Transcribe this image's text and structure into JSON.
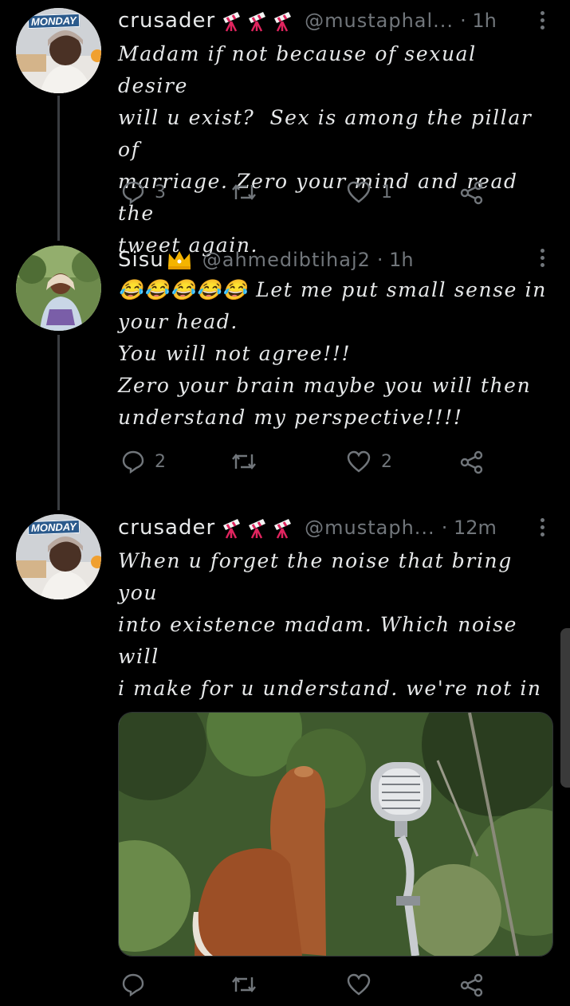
{
  "tweets": [
    {
      "avatar_badge": "MONDAY",
      "name": "crusader",
      "name_emojis": [
        "telescope-emoji",
        "telescope-emoji",
        "telescope-emoji"
      ],
      "handle": "@mustaphal...",
      "time": "· 1h",
      "text": "Madam if not because of sexual desire\nwill u exist?  Sex is among the pillar of\nmarriage. Zero your mind and read the\ntweet again.",
      "replies": "3",
      "retweets": "",
      "likes": "1"
    },
    {
      "avatar_badge": "",
      "name": "Sisu",
      "name_emojis": [
        "crown-emoji"
      ],
      "handle": "@ahmedibtihaj2",
      "time": "· 1h",
      "text": "😂😂😂😂😂 Let me put small sense in\nyour head.\nYou will not agree!!!\nZero your brain maybe you will then\nunderstand my perspective!!!!",
      "replies": "2",
      "retweets": "",
      "likes": "2"
    },
    {
      "avatar_badge": "MONDAY",
      "name": "crusader",
      "name_emojis": [
        "telescope-emoji",
        "telescope-emoji",
        "telescope-emoji"
      ],
      "handle": "@mustaph...",
      "time": "· 12m",
      "text": "When u forget the noise that bring you\ninto existence madam. Which noise will\ni make for u understand. we're not in a\nwar. simple question u can't answer u r\nhere yelling like she goat",
      "replies": "",
      "retweets": "",
      "likes": "",
      "media": "goat-with-microphone-image"
    }
  ],
  "colors": {
    "background": "#000000",
    "text": "#e7e9ea",
    "secondary": "#71767b",
    "thread_line": "#3a3d41"
  },
  "icons": [
    "reply-icon",
    "retweet-icon",
    "like-icon",
    "share-icon",
    "more-options-icon"
  ]
}
